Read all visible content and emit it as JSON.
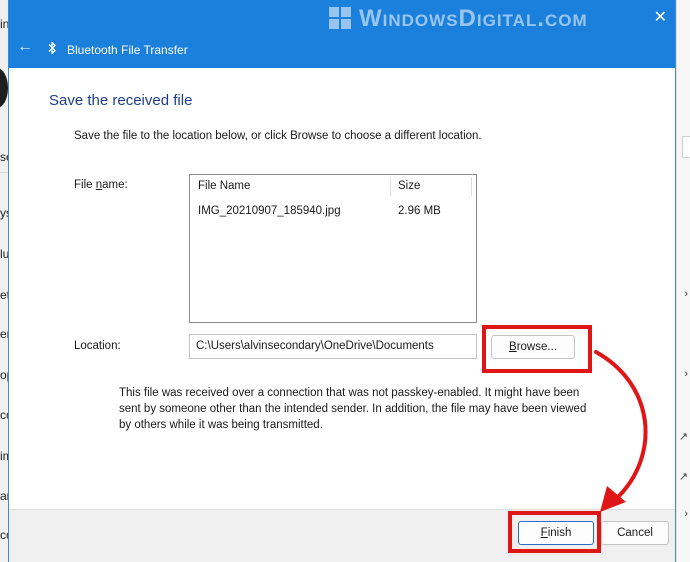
{
  "background": {
    "left_fragments": [
      "in",
      "se",
      "ys",
      "lu",
      "et",
      "er",
      "op",
      "co",
      "im",
      "ar",
      "co"
    ],
    "right_marks": [
      "›",
      "›",
      "↗",
      "↗",
      "›"
    ]
  },
  "watermark": {
    "text": "WindowsDigital.com"
  },
  "titlebar": {
    "back_glyph": "←",
    "title": "Bluetooth File Transfer",
    "close_glyph": "✕",
    "icon": "bluetooth-icon"
  },
  "dialog": {
    "heading": "Save the received file",
    "intro": "Save the file to the location below, or click Browse to choose a different location.",
    "file_name_label_pre": "File ",
    "file_name_label_accel": "n",
    "file_name_label_post": "ame:",
    "columns": [
      "File Name",
      "Size"
    ],
    "rows": [
      {
        "name": "IMG_20210907_185940.jpg",
        "size": "2.96 MB"
      }
    ],
    "location_label": "Location:",
    "location_value": "C:\\Users\\alvinsecondary\\OneDrive\\Documents",
    "browse_pre": "",
    "browse_accel": "B",
    "browse_post": "rowse...",
    "warning": "This file was received over a connection that was not passkey-enabled. It might have been sent by someone other than the intended sender.  In addition, the file may have been viewed by others while it was being transmitted."
  },
  "footer": {
    "finish_pre": "",
    "finish_accel": "F",
    "finish_post": "inish",
    "cancel_label": "Cancel"
  },
  "colors": {
    "titlebar": "#1b7fdc",
    "heading": "#1e3e8c",
    "highlight": "#e01616",
    "default_button_border": "#2a6ec9"
  }
}
